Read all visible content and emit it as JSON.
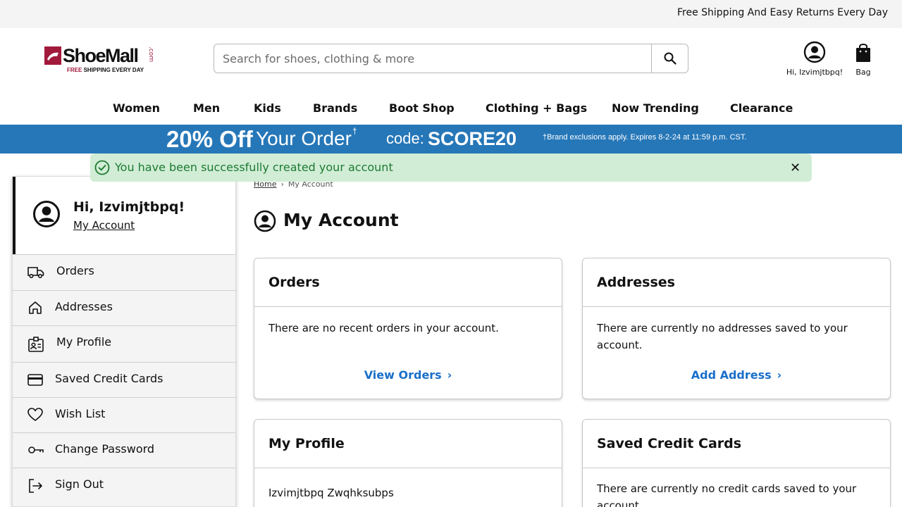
{
  "topbar": {
    "message": "Free Shipping And Easy Returns Every Day"
  },
  "logo": {
    "name": "ShoeMall",
    "domain": ".com",
    "tagline_free": "FREE",
    "tagline_rest": "SHIPPING EVERY DAY"
  },
  "search": {
    "placeholder": "Search for shoes, clothing & more"
  },
  "header": {
    "account_label": "Hi, Izvimjtbpq!",
    "bag_label": "Bag"
  },
  "nav": {
    "items": [
      "Women",
      "Men",
      "Kids",
      "Brands",
      "Boot Shop",
      "Clothing + Bags",
      "Now Trending",
      "Clearance"
    ]
  },
  "promo": {
    "amount": "20% Off",
    "text": "Your Order",
    "dagger": "†",
    "code_label": "code:",
    "code": "SCORE20",
    "fine_print": "†Brand exclusions apply. Expires 8-2-24 at 11:59 p.m. CST."
  },
  "alert": {
    "message": "You have been successfully created your account",
    "close": "✕"
  },
  "sidebar": {
    "greeting": "Hi, Izvimjtbpq!",
    "account_link": "My Account",
    "items": [
      {
        "label": "Orders",
        "icon": "truck-icon"
      },
      {
        "label": "Addresses",
        "icon": "home-icon"
      },
      {
        "label": "My Profile",
        "icon": "id-badge-icon"
      },
      {
        "label": "Saved Credit Cards",
        "icon": "credit-card-icon"
      },
      {
        "label": "Wish List",
        "icon": "heart-icon"
      },
      {
        "label": "Change Password",
        "icon": "key-icon"
      },
      {
        "label": "Sign Out",
        "icon": "sign-out-icon"
      }
    ]
  },
  "breadcrumb": {
    "home": "Home",
    "current": "My Account"
  },
  "main": {
    "title": "My Account",
    "cards": {
      "orders": {
        "title": "Orders",
        "body": "There are no recent orders in your account.",
        "action": "View Orders"
      },
      "addresses": {
        "title": "Addresses",
        "body": "There are currently no addresses saved to your account.",
        "action": "Add Address"
      },
      "profile": {
        "title": "My Profile",
        "body": "Izvimjtbpq Zwqhksubps"
      },
      "cards": {
        "title": "Saved Credit Cards",
        "body": "There are currently no credit cards saved to your account."
      }
    }
  },
  "colors": {
    "brand": "#a11a3c",
    "promo_bg": "#2677b8",
    "link": "#1a6fc9",
    "success_bg": "#d1edd6",
    "success_text": "#1e7a32"
  }
}
